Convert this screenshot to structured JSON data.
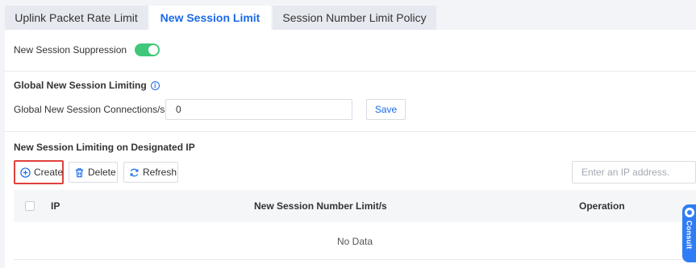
{
  "tabs": [
    {
      "label": "Uplink Packet Rate Limit"
    },
    {
      "label": "New Session Limit"
    },
    {
      "label": "Session Number Limit Policy"
    }
  ],
  "suppression": {
    "label": "New Session Suppression",
    "enabled": true
  },
  "global": {
    "title": "Global New Session Limiting",
    "connections_label": "Global New Session Connections/s",
    "connections_value": "0",
    "save_label": "Save"
  },
  "designated": {
    "title": "New Session Limiting on Designated IP",
    "create_label": "Create",
    "delete_label": "Delete",
    "refresh_label": "Refresh",
    "search_placeholder": "Enter an IP address."
  },
  "table": {
    "columns": [
      "IP",
      "New Session Number Limit/s",
      "Operation"
    ],
    "empty_text": "No Data"
  },
  "consult": {
    "label": "Consult"
  },
  "colors": {
    "accent": "#1a6ae8",
    "toggle_on": "#3fc87a",
    "highlight": "#e0413c"
  }
}
